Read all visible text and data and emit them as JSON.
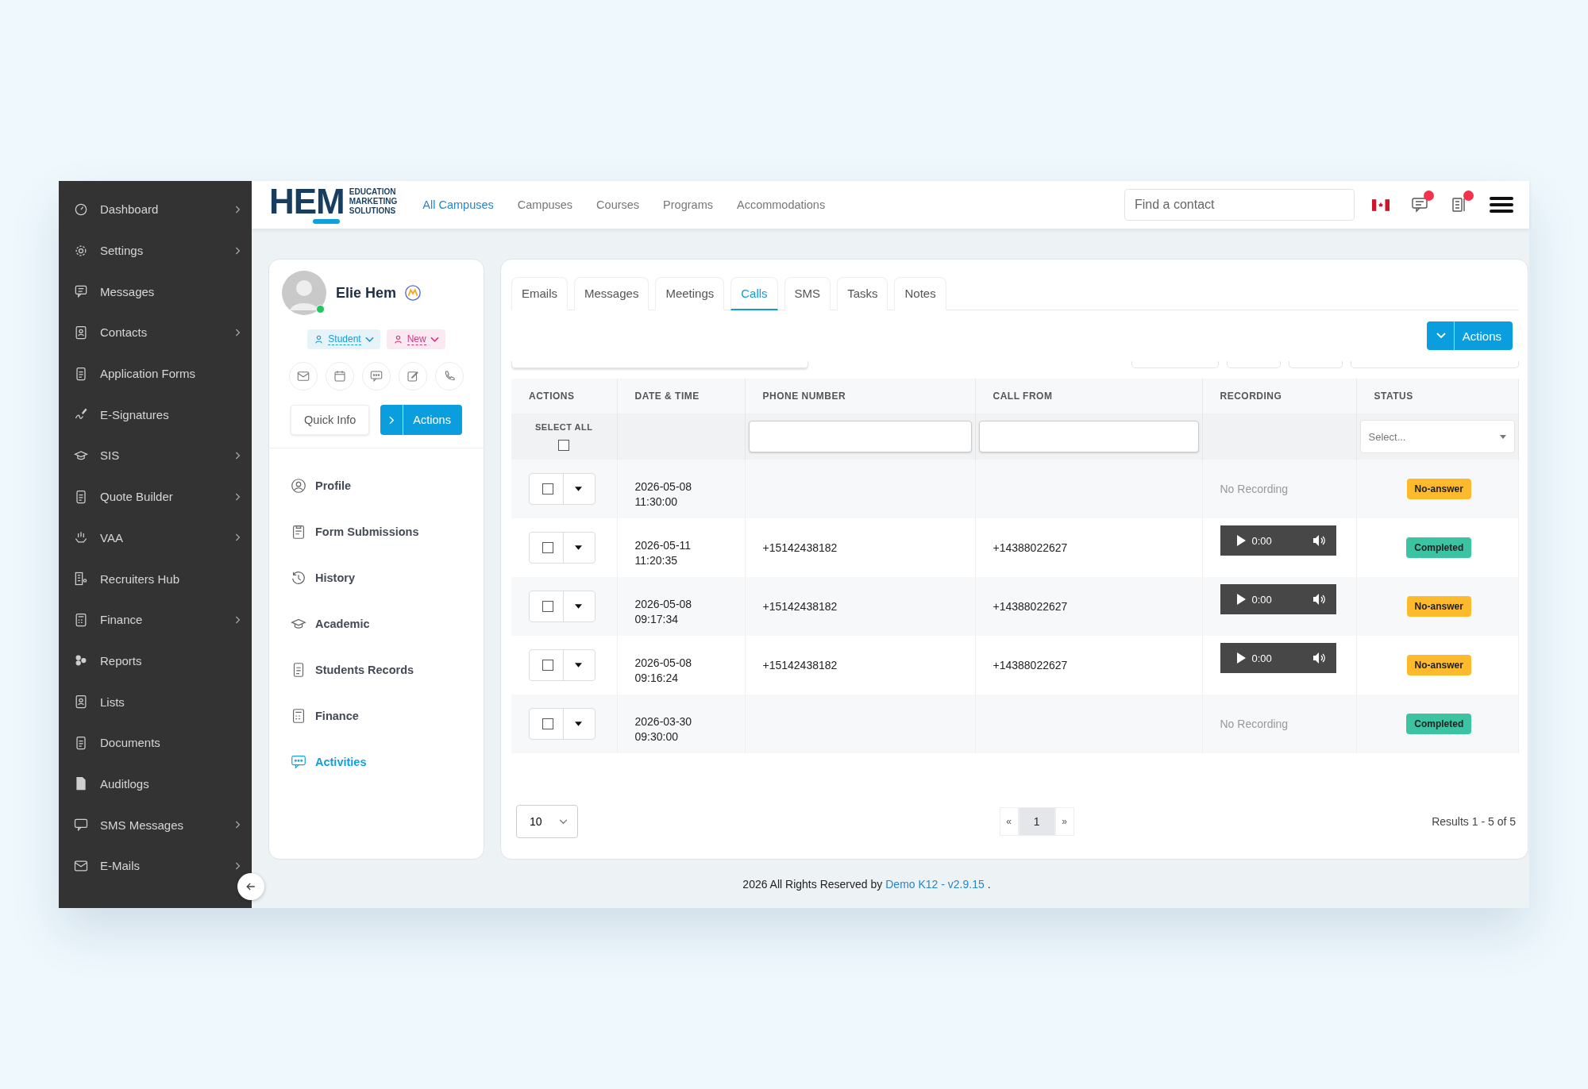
{
  "sidebar": {
    "items": [
      {
        "label": "Dashboard",
        "has_submenu": true
      },
      {
        "label": "Settings",
        "has_submenu": true
      },
      {
        "label": "Messages",
        "has_submenu": false
      },
      {
        "label": "Contacts",
        "has_submenu": true
      },
      {
        "label": "Application Forms",
        "has_submenu": false
      },
      {
        "label": "E-Signatures",
        "has_submenu": false
      },
      {
        "label": "SIS",
        "has_submenu": true
      },
      {
        "label": "Quote Builder",
        "has_submenu": true
      },
      {
        "label": "VAA",
        "has_submenu": true
      },
      {
        "label": "Recruiters Hub",
        "has_submenu": false
      },
      {
        "label": "Finance",
        "has_submenu": true
      },
      {
        "label": "Reports",
        "has_submenu": false
      },
      {
        "label": "Lists",
        "has_submenu": false
      },
      {
        "label": "Documents",
        "has_submenu": false
      },
      {
        "label": "Auditlogs",
        "has_submenu": false
      },
      {
        "label": "SMS Messages",
        "has_submenu": true
      },
      {
        "label": "E-Mails",
        "has_submenu": true
      }
    ]
  },
  "header": {
    "logo": {
      "mark": "HEM",
      "tagline": [
        "EDUCATION",
        "MARKETING",
        "SOLUTIONS"
      ]
    },
    "nav": [
      {
        "label": "All Campuses",
        "selected": true
      },
      {
        "label": "Campuses",
        "selected": false
      },
      {
        "label": "Courses",
        "selected": false
      },
      {
        "label": "Programs",
        "selected": false
      },
      {
        "label": "Accommodations",
        "selected": false
      }
    ],
    "search": {
      "placeholder": "Find a contact"
    },
    "icons": [
      {
        "kind": "flag",
        "has_notification": false
      },
      {
        "kind": "chat",
        "has_notification": true
      },
      {
        "kind": "notes",
        "has_notification": true
      },
      {
        "kind": "menu",
        "has_notification": false
      }
    ]
  },
  "profile": {
    "name": "Elie Hem",
    "online": true,
    "tags": [
      {
        "label": "Student",
        "color": "#1a9ad6"
      },
      {
        "label": "New",
        "color": "#d63384"
      }
    ],
    "buttons": [
      {
        "label": "Quick Info",
        "kind": "plain"
      },
      {
        "label": "Actions",
        "kind": "primary"
      }
    ],
    "menu": [
      {
        "label": "Profile",
        "selected": false
      },
      {
        "label": "Form Submissions",
        "selected": false
      },
      {
        "label": "History",
        "selected": false
      },
      {
        "label": "Academic",
        "selected": false
      },
      {
        "label": "Students Records",
        "selected": false
      },
      {
        "label": "Finance",
        "selected": false
      },
      {
        "label": "Activities",
        "selected": true
      }
    ]
  },
  "activity": {
    "tabs": [
      {
        "label": "Emails",
        "selected": false
      },
      {
        "label": "Messages",
        "selected": false
      },
      {
        "label": "Meetings",
        "selected": false
      },
      {
        "label": "Calls",
        "selected": true
      },
      {
        "label": "SMS",
        "selected": false
      },
      {
        "label": "Tasks",
        "selected": false
      },
      {
        "label": "Notes",
        "selected": false
      }
    ],
    "actions_button": "Actions",
    "table": {
      "columns": [
        "ACTIONS",
        "DATE & TIME",
        "PHONE NUMBER",
        "CALL FROM",
        "RECORDING",
        "STATUS"
      ],
      "select_all": {
        "label": "SELECT ALL",
        "checked": false
      },
      "status_filter": {
        "placeholder": "Select..."
      },
      "rows": [
        {
          "checked": false,
          "date": "2026-05-08",
          "time": "11:30:00",
          "recording": {
            "kind": "none",
            "label": "No Recording"
          },
          "status": {
            "label": "No-answer",
            "color": "#fdba2c"
          }
        },
        {
          "checked": false,
          "date": "2026-05-11",
          "time": "11:20:35",
          "phone": "+15142438182",
          "call_from": "+14388022627",
          "recording": {
            "kind": "player",
            "time": "0:00"
          },
          "status": {
            "label": "Completed",
            "color": "#3cc3a2"
          }
        },
        {
          "checked": false,
          "date": "2026-05-08",
          "time": "09:17:34",
          "phone": "+15142438182",
          "call_from": "+14388022627",
          "recording": {
            "kind": "player",
            "time": "0:00"
          },
          "status": {
            "label": "No-answer",
            "color": "#fdba2c"
          }
        },
        {
          "checked": false,
          "date": "2026-05-08",
          "time": "09:16:24",
          "phone": "+15142438182",
          "call_from": "+14388022627",
          "recording": {
            "kind": "player",
            "time": "0:00"
          },
          "status": {
            "label": "No-answer",
            "color": "#fdba2c"
          }
        },
        {
          "checked": false,
          "date": "2026-03-30",
          "time": "09:30:00",
          "recording": {
            "kind": "none",
            "label": "No Recording"
          },
          "status": {
            "label": "Completed",
            "color": "#3cc3a2"
          }
        }
      ]
    },
    "page_size": "10",
    "pagination": {
      "prev": "«",
      "pages": [
        {
          "label": "1",
          "selected": true
        }
      ],
      "next": "»"
    },
    "results": "Results 1 - 5 of 5"
  },
  "footer": {
    "text": "2026 All Rights Reserved by",
    "link": "Demo K12 - v2.9.15",
    "end": "."
  }
}
